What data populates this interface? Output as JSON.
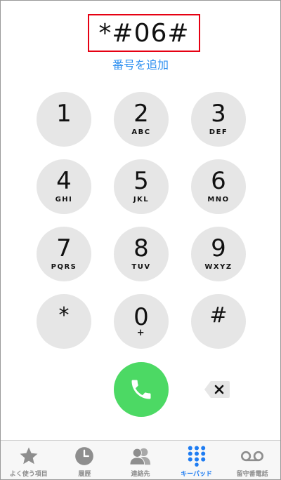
{
  "dialer": {
    "number": "*#06#",
    "add_number_label": "番号を追加"
  },
  "keypad": {
    "keys": [
      {
        "digit": "1",
        "letters": ""
      },
      {
        "digit": "2",
        "letters": "ABC"
      },
      {
        "digit": "3",
        "letters": "DEF"
      },
      {
        "digit": "4",
        "letters": "GHI"
      },
      {
        "digit": "5",
        "letters": "JKL"
      },
      {
        "digit": "6",
        "letters": "MNO"
      },
      {
        "digit": "7",
        "letters": "PQRS"
      },
      {
        "digit": "8",
        "letters": "TUV"
      },
      {
        "digit": "9",
        "letters": "WXYZ"
      },
      {
        "digit": "*",
        "letters": ""
      },
      {
        "digit": "0",
        "letters": "+"
      },
      {
        "digit": "#",
        "letters": ""
      }
    ]
  },
  "icons": {
    "call": "phone-icon",
    "backspace": "backspace-icon"
  },
  "tabbar": {
    "items": [
      {
        "label": "よく使う項目",
        "icon": "star-icon"
      },
      {
        "label": "履歴",
        "icon": "clock-icon"
      },
      {
        "label": "連絡先",
        "icon": "contacts-icon"
      },
      {
        "label": "キーパッド",
        "icon": "keypad-icon"
      },
      {
        "label": "留守番電話",
        "icon": "voicemail-icon"
      }
    ],
    "active_index": 3
  },
  "colors": {
    "accent": "#1e7cf2",
    "call_green": "#4cd964",
    "highlight_red": "#e60012",
    "key_gray": "#e6e6e6"
  }
}
